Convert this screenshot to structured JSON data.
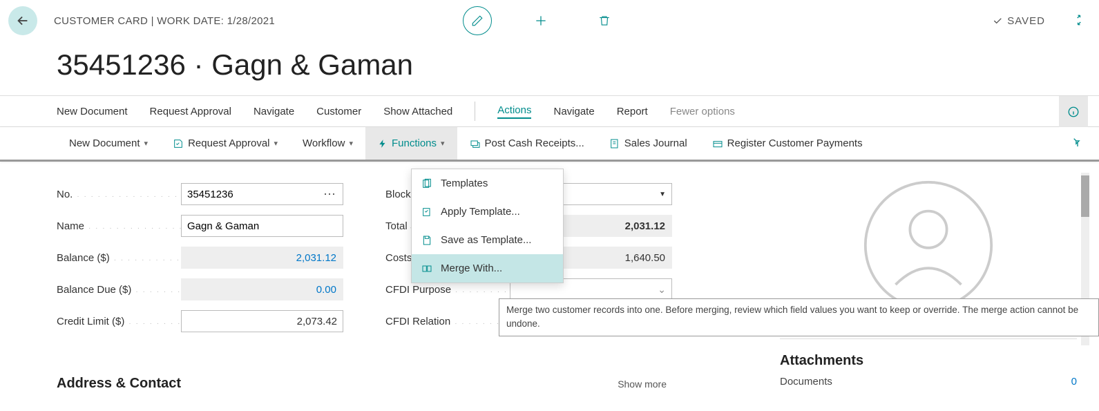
{
  "header": {
    "breadcrumb": "CUSTOMER CARD | WORK DATE: 1/28/2021",
    "saved": "SAVED",
    "title": "35451236 · Gagn & Gaman"
  },
  "menubar": {
    "items": [
      "New Document",
      "Request Approval",
      "Navigate",
      "Customer",
      "Show Attached",
      "Actions",
      "Navigate",
      "Report",
      "Fewer options"
    ]
  },
  "actionbar": {
    "new_document": "New Document",
    "request_approval": "Request Approval",
    "workflow": "Workflow",
    "functions": "Functions",
    "post_cash": "Post Cash Receipts...",
    "sales_journal": "Sales Journal",
    "register_payments": "Register Customer Payments"
  },
  "dropdown": {
    "templates": "Templates",
    "apply_template": "Apply Template...",
    "save_template": "Save as Template...",
    "merge_with": "Merge With..."
  },
  "tooltip": {
    "text": "Merge two customer records into one. Before merging, review which field values you want to keep or override. The merge action cannot be undone."
  },
  "form": {
    "left": {
      "no_label": "No.",
      "no_value": "35451236",
      "name_label": "Name",
      "name_value": "Gagn & Gaman",
      "balance_label": "Balance ($)",
      "balance_value": "2,031.12",
      "balance_due_label": "Balance Due ($)",
      "balance_due_value": "0.00",
      "credit_limit_label": "Credit Limit ($)",
      "credit_limit_value": "2,073.42"
    },
    "right": {
      "blocked_label": "Blocked",
      "blocked_value": "",
      "total_sales_label": "Total Sales",
      "total_sales_value": "2,031.12",
      "costs_label": "Costs",
      "costs_value": "1,640.50",
      "cfdi_purpose_label": "CFDI Purpose",
      "cfdi_purpose_value": "",
      "cfdi_relation_label": "CFDI Relation",
      "cfdi_relation_value": ""
    }
  },
  "sections": {
    "address_contact": "Address & Contact",
    "show_more": "Show more"
  },
  "rightpane": {
    "attachments_title": "Attachments",
    "documents_label": "Documents",
    "documents_value": "0"
  }
}
